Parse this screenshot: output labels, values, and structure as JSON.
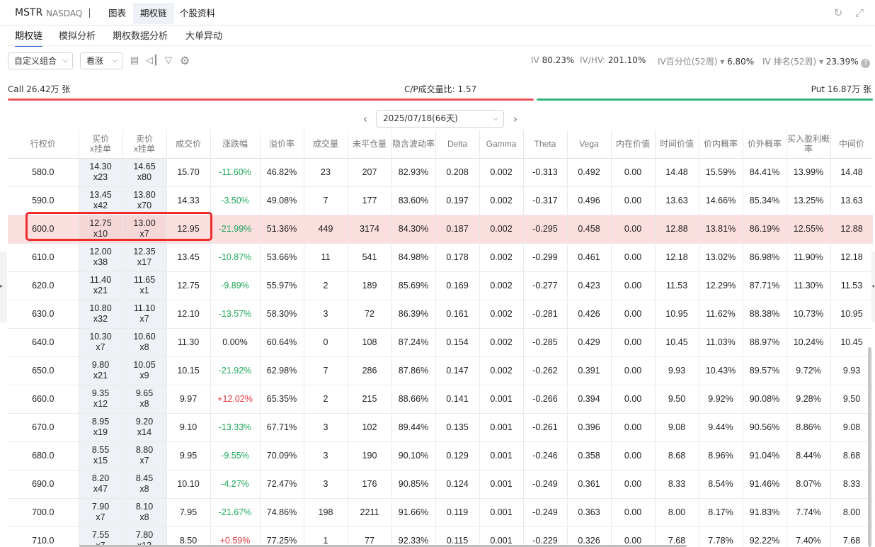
{
  "header": {
    "ticker": "MSTR",
    "exchange": "NASDAQ",
    "separator": "|",
    "tabs": [
      {
        "label": "图表",
        "active": false
      },
      {
        "label": "期权链",
        "active": true
      },
      {
        "label": "个股资料",
        "active": false
      }
    ],
    "refresh_icon": "refresh-icon",
    "expand_icon": "expand-icon"
  },
  "subtabs": [
    {
      "label": "期权链",
      "active": true
    },
    {
      "label": "模拟分析",
      "active": false
    },
    {
      "label": "期权数据分析",
      "active": false
    },
    {
      "label": "大单异动",
      "active": false
    }
  ],
  "toolbar": {
    "combo_select": "自定义组合",
    "direction_select": "看涨",
    "icons": [
      "table-layout-icon",
      "split-view-icon",
      "filter-icon",
      "settings-gear-icon"
    ],
    "iv_label": "IV",
    "iv_value": "80.23%",
    "ivhv_label": "IV/HV:",
    "ivhv_value": "201.10%",
    "ivpct_label": "IV百分位(52周)",
    "ivpct_value": "6.80%",
    "ivrank_label": "IV 排名(52周)",
    "ivrank_value": "23.39%",
    "help_icon": "?"
  },
  "cp": {
    "call_label": "Call 26.42万 张",
    "ratio_label": "C/P成交量比: 1.57",
    "put_label": "Put 16.87万 张",
    "call_share": 0.61,
    "call_color": "#e8545a",
    "put_color": "#2fb57c"
  },
  "expiry": {
    "prev": "‹",
    "value": "2025/07/18(66天)",
    "next": "›"
  },
  "table": {
    "headers": [
      {
        "l1": "行权价"
      },
      {
        "l1": "买价",
        "l2": "x挂单"
      },
      {
        "l1": "卖价",
        "l2": "x挂单"
      },
      {
        "l1": "成交价"
      },
      {
        "l1": "涨跌幅"
      },
      {
        "l1": "溢价率"
      },
      {
        "l1": "成交量"
      },
      {
        "l1": "未平仓量"
      },
      {
        "l1": "隐含波动率"
      },
      {
        "l1": "Delta"
      },
      {
        "l1": "Gamma"
      },
      {
        "l1": "Theta"
      },
      {
        "l1": "Vega"
      },
      {
        "l1": "内在价值"
      },
      {
        "l1": "时间价值"
      },
      {
        "l1": "价内概率"
      },
      {
        "l1": "价外概率"
      },
      {
        "l1": "买入盈利概",
        "l2": "率"
      },
      {
        "l1": "中间价"
      }
    ],
    "rows": [
      {
        "strike": "580.0",
        "bid": "14.30",
        "bid_size": "x23",
        "ask": "14.65",
        "ask_size": "x80",
        "last": "15.70",
        "chg": "-11.60%",
        "chg_dir": "neg",
        "premium": "46.82%",
        "volume": "23",
        "oi": "207",
        "iv": "82.93%",
        "delta": "0.208",
        "gamma": "0.002",
        "theta": "-0.313",
        "vega": "0.492",
        "intrinsic": "0.00",
        "time_value": "14.48",
        "itm": "15.59%",
        "otm": "84.41%",
        "profit": "13.99%",
        "mid": "14.48"
      },
      {
        "strike": "590.0",
        "bid": "13.45",
        "bid_size": "x42",
        "ask": "13.80",
        "ask_size": "x70",
        "last": "14.33",
        "chg": "-3.50%",
        "chg_dir": "neg",
        "premium": "49.08%",
        "volume": "7",
        "oi": "177",
        "iv": "83.60%",
        "delta": "0.197",
        "gamma": "0.002",
        "theta": "-0.317",
        "vega": "0.496",
        "intrinsic": "0.00",
        "time_value": "13.63",
        "itm": "14.66%",
        "otm": "85.34%",
        "profit": "13.25%",
        "mid": "13.63"
      },
      {
        "strike": "600.0",
        "bid": "12.75",
        "bid_size": "x10",
        "ask": "13.00",
        "ask_size": "x7",
        "last": "12.95",
        "chg": "-21.99%",
        "chg_dir": "neg",
        "premium": "51.36%",
        "volume": "449",
        "oi": "3174",
        "iv": "84.30%",
        "delta": "0.187",
        "gamma": "0.002",
        "theta": "-0.295",
        "vega": "0.458",
        "intrinsic": "0.00",
        "time_value": "12.88",
        "itm": "13.81%",
        "otm": "86.19%",
        "profit": "12.55%",
        "mid": "12.88",
        "highlight": true
      },
      {
        "strike": "610.0",
        "bid": "12.00",
        "bid_size": "x38",
        "ask": "12.35",
        "ask_size": "x17",
        "last": "13.45",
        "chg": "-10.87%",
        "chg_dir": "neg",
        "premium": "53.66%",
        "volume": "11",
        "oi": "541",
        "iv": "84.98%",
        "delta": "0.178",
        "gamma": "0.002",
        "theta": "-0.299",
        "vega": "0.461",
        "intrinsic": "0.00",
        "time_value": "12.18",
        "itm": "13.02%",
        "otm": "86.98%",
        "profit": "11.90%",
        "mid": "12.18"
      },
      {
        "strike": "620.0",
        "bid": "11.40",
        "bid_size": "x21",
        "ask": "11.65",
        "ask_size": "x1",
        "last": "12.75",
        "chg": "-9.89%",
        "chg_dir": "neg",
        "premium": "55.97%",
        "volume": "2",
        "oi": "189",
        "iv": "85.69%",
        "delta": "0.169",
        "gamma": "0.002",
        "theta": "-0.277",
        "vega": "0.423",
        "intrinsic": "0.00",
        "time_value": "11.53",
        "itm": "12.29%",
        "otm": "87.71%",
        "profit": "11.30%",
        "mid": "11.53"
      },
      {
        "strike": "630.0",
        "bid": "10.80",
        "bid_size": "x32",
        "ask": "11.10",
        "ask_size": "x7",
        "last": "12.10",
        "chg": "-13.57%",
        "chg_dir": "neg",
        "premium": "58.30%",
        "volume": "3",
        "oi": "72",
        "iv": "86.39%",
        "delta": "0.161",
        "gamma": "0.002",
        "theta": "-0.281",
        "vega": "0.426",
        "intrinsic": "0.00",
        "time_value": "10.95",
        "itm": "11.62%",
        "otm": "88.38%",
        "profit": "10.73%",
        "mid": "10.95"
      },
      {
        "strike": "640.0",
        "bid": "10.30",
        "bid_size": "x7",
        "ask": "10.60",
        "ask_size": "x8",
        "last": "11.30",
        "chg": "0.00%",
        "chg_dir": "neu",
        "premium": "60.64%",
        "volume": "0",
        "oi": "108",
        "iv": "87.24%",
        "delta": "0.154",
        "gamma": "0.002",
        "theta": "-0.285",
        "vega": "0.429",
        "intrinsic": "0.00",
        "time_value": "10.45",
        "itm": "11.03%",
        "otm": "88.97%",
        "profit": "10.24%",
        "mid": "10.45"
      },
      {
        "strike": "650.0",
        "bid": "9.80",
        "bid_size": "x21",
        "ask": "10.05",
        "ask_size": "x9",
        "last": "10.15",
        "chg": "-21.92%",
        "chg_dir": "neg",
        "premium": "62.98%",
        "volume": "7",
        "oi": "286",
        "iv": "87.86%",
        "delta": "0.147",
        "gamma": "0.002",
        "theta": "-0.262",
        "vega": "0.391",
        "intrinsic": "0.00",
        "time_value": "9.93",
        "itm": "10.43%",
        "otm": "89.57%",
        "profit": "9.72%",
        "mid": "9.93"
      },
      {
        "strike": "660.0",
        "bid": "9.35",
        "bid_size": "x12",
        "ask": "9.65",
        "ask_size": "x8",
        "last": "9.97",
        "chg": "+12.02%",
        "chg_dir": "pos",
        "premium": "65.35%",
        "volume": "2",
        "oi": "215",
        "iv": "88.66%",
        "delta": "0.141",
        "gamma": "0.001",
        "theta": "-0.266",
        "vega": "0.394",
        "intrinsic": "0.00",
        "time_value": "9.50",
        "itm": "9.92%",
        "otm": "90.08%",
        "profit": "9.28%",
        "mid": "9.50"
      },
      {
        "strike": "670.0",
        "bid": "8.95",
        "bid_size": "x19",
        "ask": "9.20",
        "ask_size": "x14",
        "last": "9.10",
        "chg": "-13.33%",
        "chg_dir": "neg",
        "premium": "67.71%",
        "volume": "3",
        "oi": "102",
        "iv": "89.44%",
        "delta": "0.135",
        "gamma": "0.001",
        "theta": "-0.261",
        "vega": "0.396",
        "intrinsic": "0.00",
        "time_value": "9.08",
        "itm": "9.44%",
        "otm": "90.56%",
        "profit": "8.86%",
        "mid": "9.08"
      },
      {
        "strike": "680.0",
        "bid": "8.55",
        "bid_size": "x15",
        "ask": "8.80",
        "ask_size": "x7",
        "last": "9.95",
        "chg": "-9.55%",
        "chg_dir": "neg",
        "premium": "70.09%",
        "volume": "3",
        "oi": "190",
        "iv": "90.10%",
        "delta": "0.129",
        "gamma": "0.001",
        "theta": "-0.246",
        "vega": "0.358",
        "intrinsic": "0.00",
        "time_value": "8.68",
        "itm": "8.96%",
        "otm": "91.04%",
        "profit": "8.44%",
        "mid": "8.68"
      },
      {
        "strike": "690.0",
        "bid": "8.20",
        "bid_size": "x47",
        "ask": "8.45",
        "ask_size": "x8",
        "last": "10.10",
        "chg": "-4.27%",
        "chg_dir": "neg",
        "premium": "72.47%",
        "volume": "3",
        "oi": "176",
        "iv": "90.85%",
        "delta": "0.124",
        "gamma": "0.001",
        "theta": "-0.249",
        "vega": "0.361",
        "intrinsic": "0.00",
        "time_value": "8.33",
        "itm": "8.54%",
        "otm": "91.46%",
        "profit": "8.07%",
        "mid": "8.33"
      },
      {
        "strike": "700.0",
        "bid": "7.90",
        "bid_size": "x7",
        "ask": "8.10",
        "ask_size": "x8",
        "last": "7.95",
        "chg": "-21.67%",
        "chg_dir": "neg",
        "premium": "74.86%",
        "volume": "198",
        "oi": "2211",
        "iv": "91.66%",
        "delta": "0.119",
        "gamma": "0.001",
        "theta": "-0.249",
        "vega": "0.363",
        "intrinsic": "0.00",
        "time_value": "8.00",
        "itm": "8.17%",
        "otm": "91.83%",
        "profit": "7.74%",
        "mid": "8.00"
      },
      {
        "strike": "710.0",
        "bid": "7.55",
        "bid_size": "x7",
        "ask": "7.80",
        "ask_size": "x13",
        "last": "8.50",
        "chg": "+0.59%",
        "chg_dir": "pos",
        "premium": "77.25%",
        "volume": "1",
        "oi": "77",
        "iv": "92.33%",
        "delta": "0.115",
        "gamma": "0.001",
        "theta": "-0.229",
        "vega": "0.326",
        "intrinsic": "0.00",
        "time_value": "7.68",
        "itm": "7.78%",
        "otm": "92.22%",
        "profit": "7.40%",
        "mid": "7.68"
      }
    ]
  }
}
